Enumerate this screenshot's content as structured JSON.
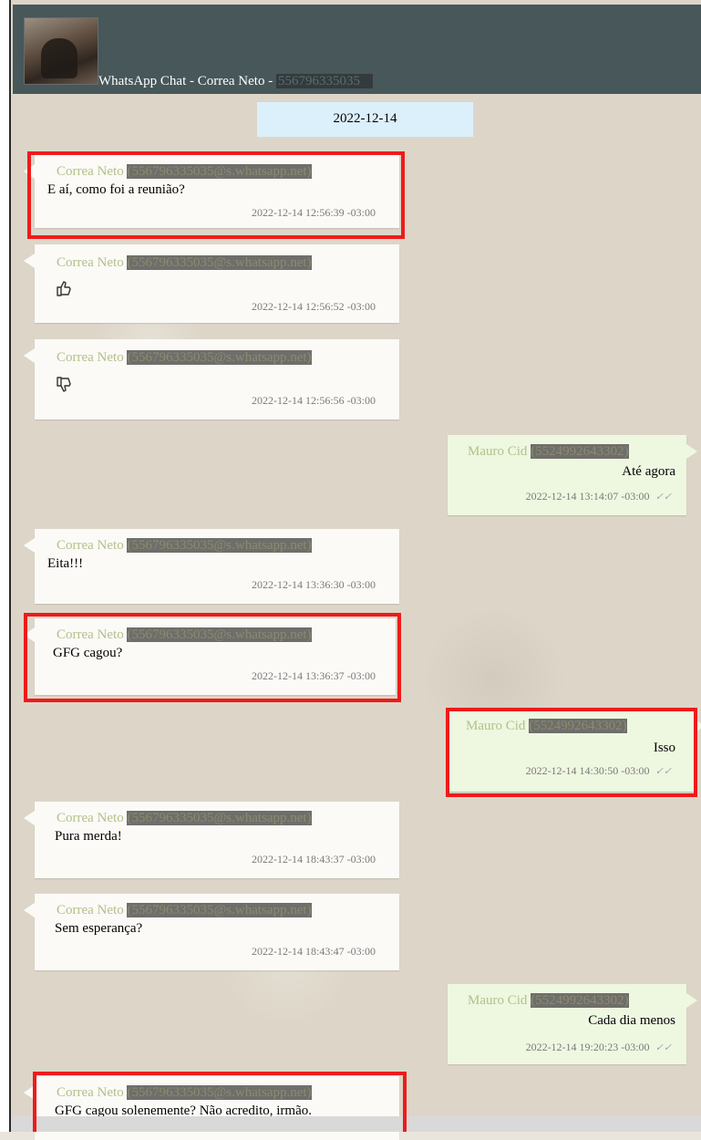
{
  "header": {
    "title_prefix": "WhatsApp Chat - Correa Neto - ",
    "title_number": "556796335035"
  },
  "date_chip": "2022-12-14",
  "messages": [
    {
      "sender": "Correa Neto",
      "sender_id": "(556796335035@s.whatsapp.net)",
      "text": "E aí, como foi a reunião?",
      "time": "2022-12-14 12:56:39 -03:00"
    },
    {
      "sender": "Correa Neto",
      "sender_id": "(556796335035@s.whatsapp.net)",
      "emoji": "thumbs-up-icon",
      "time": "2022-12-14 12:56:52 -03:00"
    },
    {
      "sender": "Correa Neto",
      "sender_id": "(556796335035@s.whatsapp.net)",
      "emoji": "thumbs-down-icon",
      "time": "2022-12-14 12:56:56 -03:00"
    },
    {
      "sender": "Mauro Cid",
      "sender_id": "(5524992643302)",
      "text": "Até agora",
      "time": "2022-12-14 13:14:07 -03:00"
    },
    {
      "sender": "Correa Neto",
      "sender_id": "(556796335035@s.whatsapp.net)",
      "text": "Eita!!!",
      "time": "2022-12-14 13:36:30 -03:00"
    },
    {
      "sender": "Correa Neto",
      "sender_id": "(556796335035@s.whatsapp.net)",
      "text": "GFG cagou?",
      "time": "2022-12-14 13:36:37 -03:00"
    },
    {
      "sender": "Mauro Cid",
      "sender_id": "(5524992643302)",
      "text": "Isso",
      "time": "2022-12-14 14:30:50 -03:00"
    },
    {
      "sender": "Correa Neto",
      "sender_id": "(556796335035@s.whatsapp.net)",
      "text": "Pura merda!",
      "time": "2022-12-14 18:43:37 -03:00"
    },
    {
      "sender": "Correa Neto",
      "sender_id": "(556796335035@s.whatsapp.net)",
      "text": "Sem esperança?",
      "time": "2022-12-14 18:43:47 -03:00"
    },
    {
      "sender": "Mauro Cid",
      "sender_id": "(5524992643302)",
      "text": "Cada dia menos",
      "time": "2022-12-14 19:20:23 -03:00"
    },
    {
      "sender": "Correa Neto",
      "sender_id": "(556796335035@s.whatsapp.net)",
      "text": "GFG cagou solenemente? Não acredito, irmão."
    }
  ],
  "ticks": "✓✓"
}
